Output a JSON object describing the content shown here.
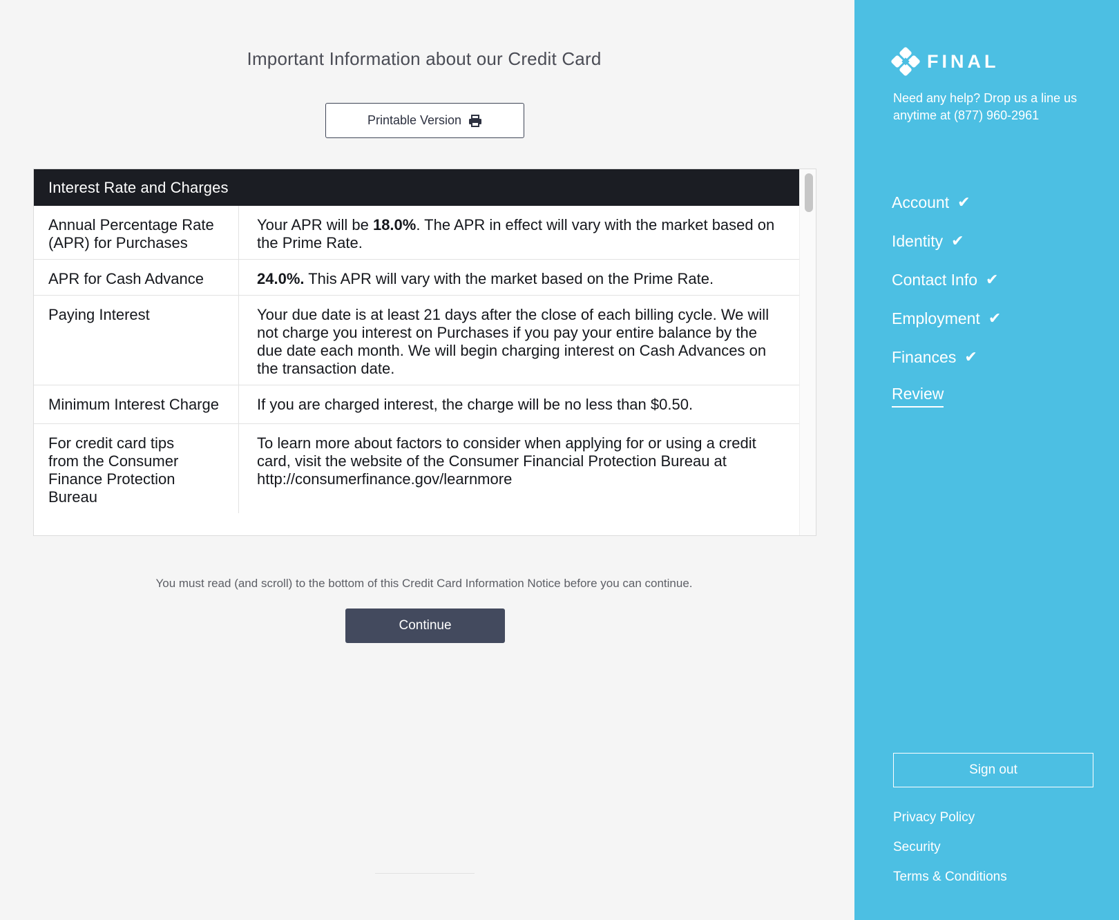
{
  "main": {
    "title": "Important Information about our Credit Card",
    "print_label": "Printable Version",
    "card_title": "Interest Rate and Charges",
    "rows": [
      {
        "label": "Annual Percentage Rate (APR) for Purchases",
        "pre": "Your APR will be ",
        "bold": "18.0%",
        "post": ". The APR in effect will vary with the market based on the Prime Rate."
      },
      {
        "label": "APR for Cash Advance",
        "pre": "",
        "bold": "24.0%.",
        "post": " This APR will vary with the market based on the Prime Rate."
      },
      {
        "label": "Paying Interest",
        "pre": "Your due date is at least 21 days after the close of each billing cycle. We will not charge you interest on Purchases if you pay your entire balance by the due date each month. We will begin charging interest on Cash Advances on the transaction date.",
        "bold": "",
        "post": ""
      },
      {
        "label": "Minimum Interest Charge",
        "pre": "If you are charged interest, the charge will be no less than $0.50.",
        "bold": "",
        "post": ""
      },
      {
        "label": "For credit card tips from the Consumer Finance Protection Bureau",
        "pre": "To learn more about factors to consider when applying for or using a credit card, visit the website of the Consumer Financial Protection Bureau at http://consumerfinance.gov/learnmore",
        "bold": "",
        "post": ""
      }
    ],
    "notice": "You must read (and scroll) to the bottom of this Credit Card Information Notice before you can continue.",
    "continue_label": "Continue"
  },
  "sidebar": {
    "brand": "FINAL",
    "help": "Need any help? Drop us a line us anytime at (877) 960-2961",
    "nav": [
      {
        "label": "Account",
        "check": "✔"
      },
      {
        "label": "Identity",
        "check": "✔"
      },
      {
        "label": "Contact Info",
        "check": "✔"
      },
      {
        "label": "Employment",
        "check": "✔"
      },
      {
        "label": "Finances",
        "check": "✔"
      },
      {
        "label": "Review",
        "check": ""
      }
    ],
    "signout_label": "Sign out",
    "links": [
      "Privacy Policy",
      "Security",
      "Terms & Conditions"
    ]
  },
  "icons": {
    "print": "printer-icon",
    "logo": "final-logo-icon",
    "check": "checkmark-icon"
  },
  "colors": {
    "sidebar_bg": "#4cbfe3",
    "card_header_bg": "#1b1d23",
    "continue_bg": "#434a5e",
    "page_bg": "#f5f5f5"
  }
}
